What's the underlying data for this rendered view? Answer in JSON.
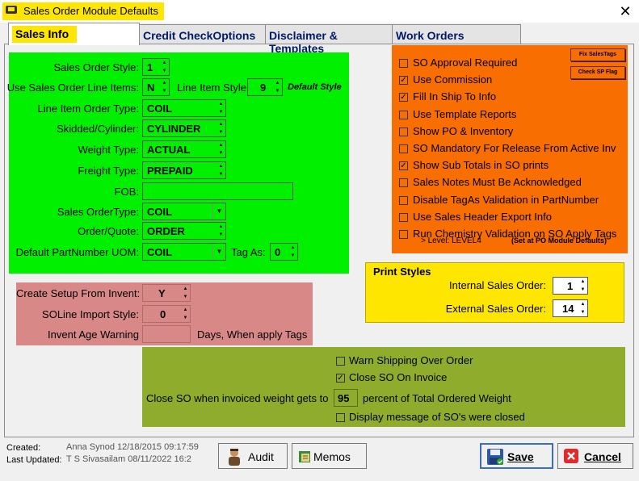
{
  "window": {
    "title": "Sales Order Module Defaults",
    "close": "✕"
  },
  "tabs": [
    {
      "label": "Sales Info",
      "active": true
    },
    {
      "label": "Credit CheckOptions",
      "active": false
    },
    {
      "label": "Disclaimer & Templates",
      "active": false
    },
    {
      "label": "Work Orders",
      "active": false
    }
  ],
  "sales": {
    "so_style_label": "Sales Order Style:",
    "so_style": "1",
    "use_line_items_label": "Use Sales Order Line Items:",
    "use_line_items": "N",
    "line_item_style_label": "Line Item Style:",
    "line_item_style": "9",
    "line_item_style_note": "Default Style",
    "line_item_order_type_label": "Line Item Order Type:",
    "line_item_order_type": "COIL",
    "skidded_label": "Skidded/Cylinder:",
    "skidded": "CYLINDER",
    "weight_type_label": "Weight Type:",
    "weight_type": "ACTUAL",
    "freight_type_label": "Freight Type:",
    "freight_type": "PREPAID",
    "fob_label": "FOB:",
    "fob": "",
    "so_type_label": "Sales OrderType:",
    "so_type": "COIL",
    "order_quote_label": "Order/Quote:",
    "order_quote": "ORDER",
    "uom_label": "Default PartNumber UOM:",
    "uom": "COIL",
    "tag_as_label": "Tag As:",
    "tag_as": "0"
  },
  "options": {
    "fix_sales_tags": "Fix SalesTags",
    "check_sp_flag": "Check SP Flag",
    "items": [
      {
        "label": "SO Approval Required",
        "checked": false
      },
      {
        "label": "Use Commission",
        "checked": true
      },
      {
        "label": "Fill In Ship To Info",
        "checked": true
      },
      {
        "label": "Use Template Reports",
        "checked": false
      },
      {
        "label": "Show PO & Inventory",
        "checked": false
      },
      {
        "label": "SO Mandatory For Release From Active Inv",
        "checked": false
      },
      {
        "label": "Show Sub Totals in SO prints",
        "checked": true
      },
      {
        "label": "Sales Notes Must Be Acknowledged",
        "checked": false
      },
      {
        "label": "Disable TagAs Validation in PartNumber",
        "checked": false
      },
      {
        "label": "Use Sales Header Export Info",
        "checked": false
      },
      {
        "label": "Run Chemistry Validation on SO Apply Tags",
        "checked": false
      }
    ],
    "level_text": "> Level:  LEVEL4",
    "level_note": "(Set at PO Module Defaults)"
  },
  "print_styles": {
    "title": "Print Styles",
    "internal_label": "Internal Sales Order:",
    "internal": "1",
    "external_label": "External Sales Order:",
    "external": "14"
  },
  "setup": {
    "create_label": "Create Setup From Invent:",
    "create": "Y",
    "import_label": "SOLine Import Style:",
    "import": "0",
    "age_label": "Invent Age Warning",
    "age": "",
    "age_suffix": "Days, When apply Tags"
  },
  "shipping": {
    "warn_label": "Warn Shipping Over Order",
    "warn": false,
    "close_label": "Close SO On Invoice",
    "close": true,
    "weight_label": "Close SO when invoiced weight gets to",
    "weight_value": "95",
    "weight_suffix": "percent of Total Ordered Weight",
    "display_label": "Display message of SO's were closed",
    "display": false
  },
  "footer": {
    "created_label": "Created:",
    "created_value": "Anna Synod 12/18/2015 09:17:59",
    "updated_label": "Last Updated:",
    "updated_value": "T S Sivasailam 08/11/2022 16:2",
    "audit": "Audit",
    "memos": "Memos",
    "save": "Save",
    "cancel": "Cancel"
  }
}
